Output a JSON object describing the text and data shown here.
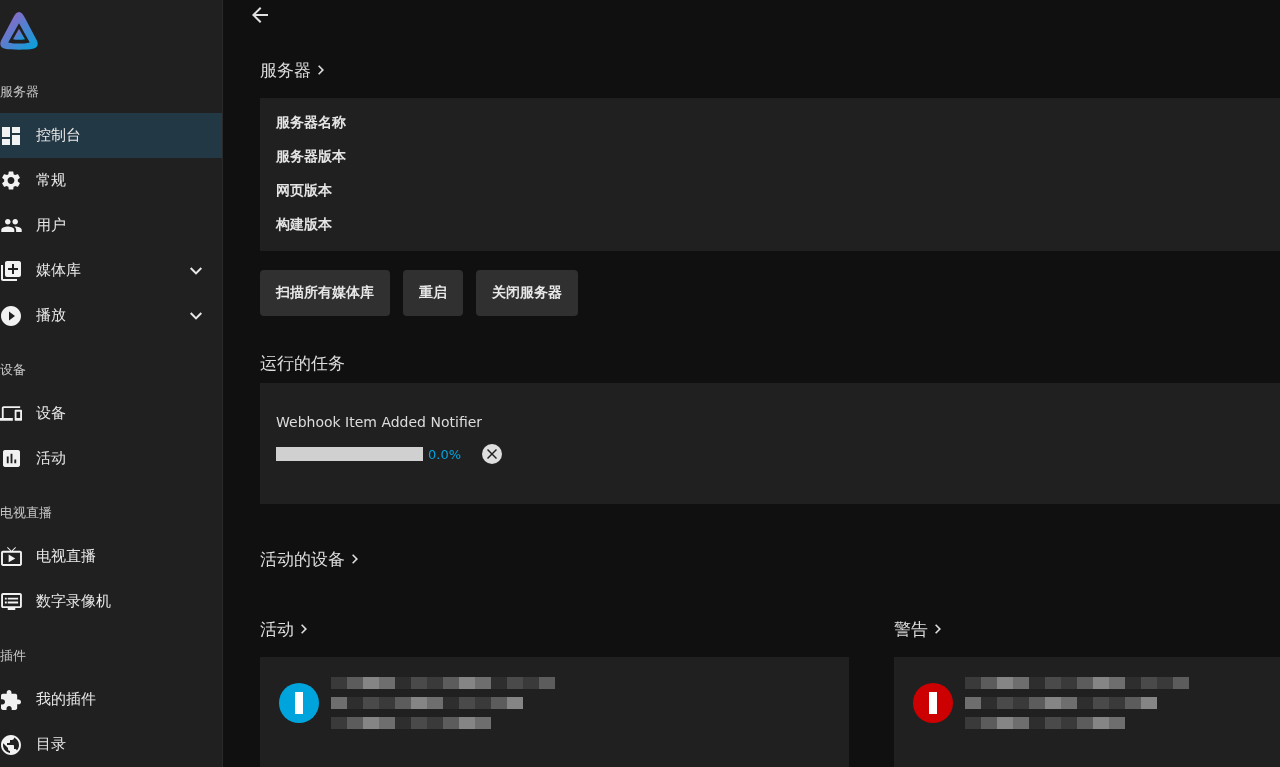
{
  "sidebar": {
    "sections": [
      {
        "title": "服务器",
        "items": [
          {
            "label": "控制台",
            "selected": true
          },
          {
            "label": "常规",
            "selected": false
          },
          {
            "label": "用户",
            "selected": false
          },
          {
            "label": "媒体库",
            "selected": false,
            "expanded": false
          },
          {
            "label": "播放",
            "selected": false,
            "expanded": false
          }
        ]
      },
      {
        "title": "设备",
        "items": [
          {
            "label": "设备",
            "selected": false
          },
          {
            "label": "活动",
            "selected": false
          }
        ]
      },
      {
        "title": "电视直播",
        "items": [
          {
            "label": "电视直播",
            "selected": false
          },
          {
            "label": "数字录像机",
            "selected": false
          }
        ]
      },
      {
        "title": "插件",
        "items": [
          {
            "label": "我的插件",
            "selected": false
          },
          {
            "label": "目录",
            "selected": false
          }
        ]
      }
    ]
  },
  "server": {
    "heading": {
      "text": "服务器",
      "link": true
    },
    "info_rows": [
      "服务器名称",
      "服务器版本",
      "网页版本",
      "构建版本"
    ],
    "buttons": [
      "扫描所有媒体库",
      "重启",
      "关闭服务器"
    ]
  },
  "running_tasks": {
    "heading": {
      "text": "运行的任务",
      "link": false
    },
    "tasks": [
      {
        "name": "Webhook Item Added Notifier",
        "level": 0,
        "reading": "0.0%"
      }
    ]
  },
  "active_devices": {
    "heading": {
      "text": "活动的设备",
      "link": true
    }
  },
  "activity": {
    "heading": {
      "text": "活动",
      "link": true
    },
    "entries": [
      {
        "kind": "obscured",
        "color": "#00a4dc"
      }
    ]
  },
  "alerts": {
    "heading": {
      "text": "警告",
      "link": true
    },
    "entries": [
      {
        "kind": "obscured",
        "color": "#cc0000"
      }
    ]
  }
}
